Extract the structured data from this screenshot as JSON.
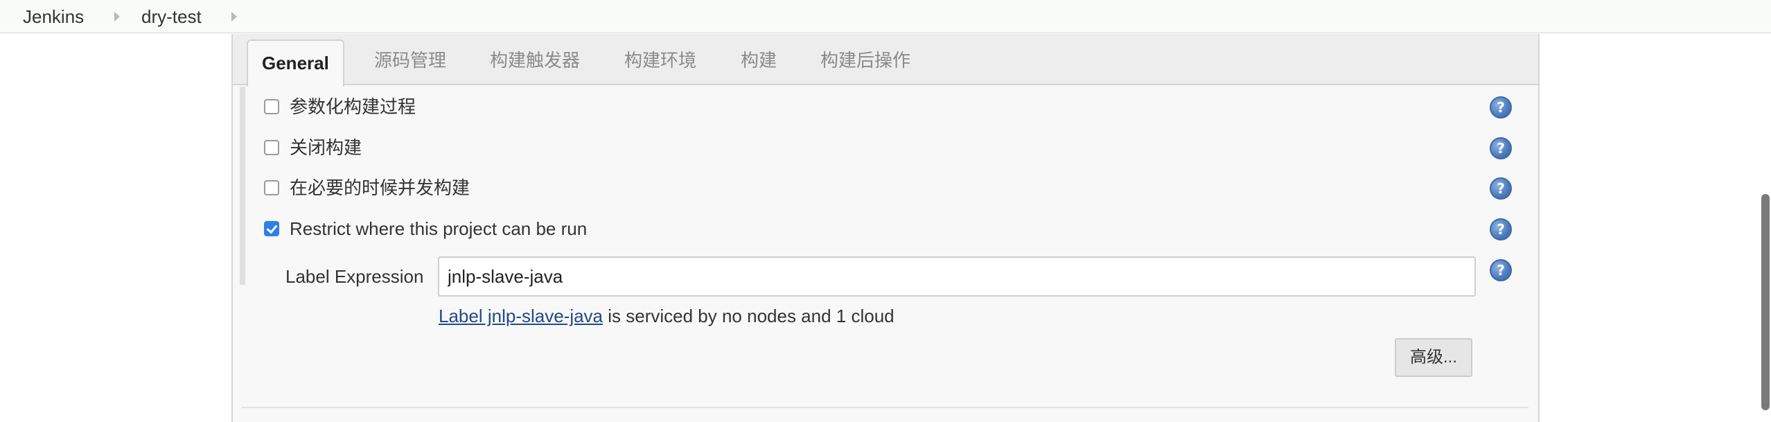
{
  "breadcrumb": {
    "items": [
      "Jenkins",
      "dry-test"
    ]
  },
  "tabs": [
    "General",
    "源码管理",
    "构建触发器",
    "构建环境",
    "构建",
    "构建后操作"
  ],
  "active_tab": "General",
  "options": [
    {
      "label": "参数化构建过程",
      "checked": false
    },
    {
      "label": "关闭构建",
      "checked": false
    },
    {
      "label": "在必要的时候并发构建",
      "checked": false
    },
    {
      "label": "Restrict where this project can be run",
      "checked": true
    }
  ],
  "label_expression": {
    "label": "Label Expression",
    "value": "jnlp-slave-java",
    "info_link": "Label jnlp-slave-java",
    "info_text": " is serviced by no nodes and 1 cloud"
  },
  "advanced_button": "高级...",
  "help_glyph": "?",
  "icons": {
    "help": "help-icon",
    "breadcrumb_separator": "chevron-right-icon"
  },
  "colors": {
    "checkbox_checked": "#2e80e8",
    "link": "#204a87",
    "help_icon": "#4f7fbf"
  }
}
